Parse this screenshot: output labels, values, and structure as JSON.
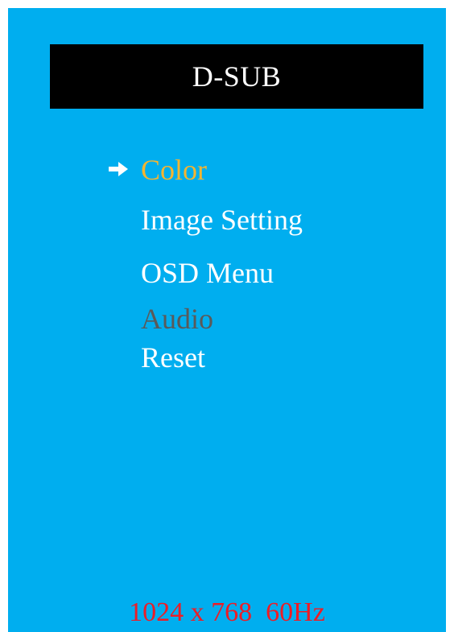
{
  "osd": {
    "title": "D-SUB",
    "menu": [
      {
        "label": "Color",
        "state": "selected"
      },
      {
        "label": "Image Setting",
        "state": "normal"
      },
      {
        "label": "OSD Menu",
        "state": "normal"
      },
      {
        "label": "Audio",
        "state": "disabled"
      },
      {
        "label": "Reset",
        "state": "normal"
      }
    ],
    "selector_icon": "right-arrow-icon",
    "status": {
      "resolution": "1024 x 768",
      "refresh": "60Hz"
    }
  },
  "colors": {
    "panel_background": "#00aeef",
    "title_background": "#000000",
    "menu_text": "#ffffff",
    "menu_selected": "#f5b530",
    "menu_disabled": "#5a5a5a",
    "status_text": "#ee1c25"
  }
}
